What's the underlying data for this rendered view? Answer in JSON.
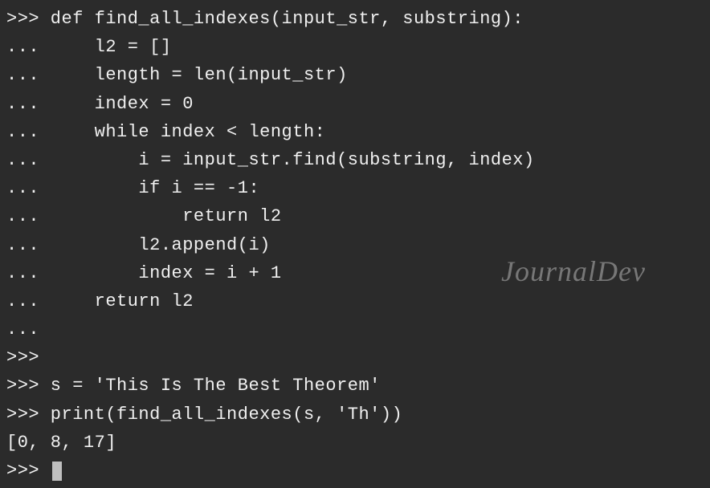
{
  "terminal": {
    "lines": [
      ">>> def find_all_indexes(input_str, substring):",
      "...     l2 = []",
      "...     length = len(input_str)",
      "...     index = 0",
      "...     while index < length:",
      "...         i = input_str.find(substring, index)",
      "...         if i == -1:",
      "...             return l2",
      "...         l2.append(i)",
      "...         index = i + 1",
      "...     return l2",
      "... ",
      ">>> ",
      ">>> s = 'This Is The Best Theorem'",
      ">>> print(find_all_indexes(s, 'Th'))",
      "[0, 8, 17]",
      ">>> "
    ]
  },
  "watermark": "JournalDev"
}
